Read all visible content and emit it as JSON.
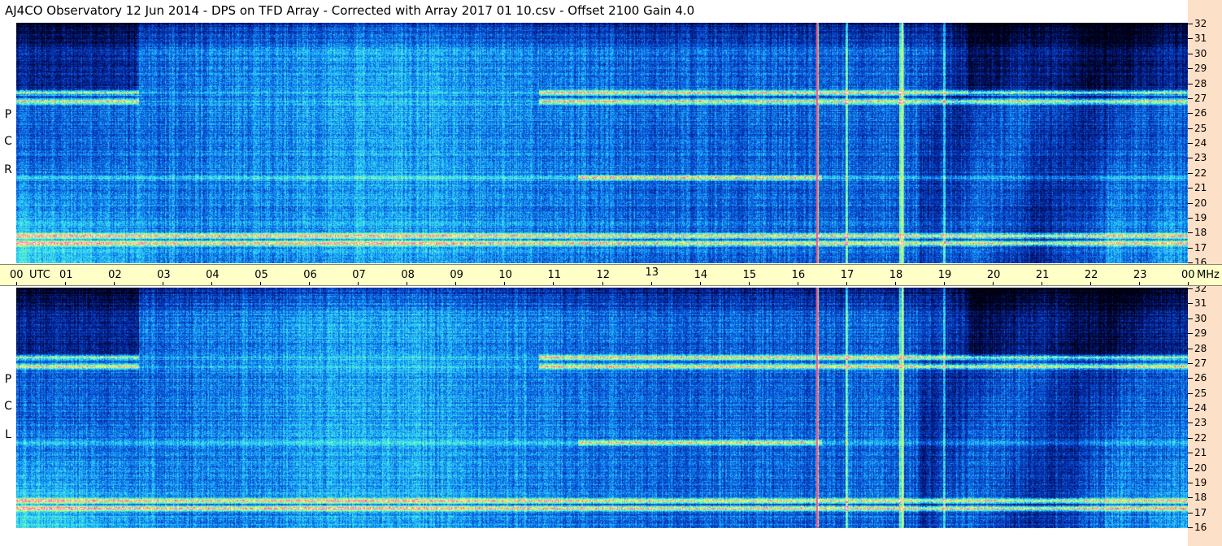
{
  "title": "AJ4CO Observatory  12 Jun 2014  -  DPS on TFD Array  -  Corrected with Array 2017 01 10.csv  -  Offset 2100  Gain 4.0",
  "panels": [
    {
      "name": "rcp",
      "label_letters": [
        "P",
        "C",
        "R"
      ]
    },
    {
      "name": "lcp",
      "label_letters": [
        "P",
        "C",
        "L"
      ]
    }
  ],
  "chart_data": {
    "type": "heatmap",
    "subtype": "dynamic spectrogram",
    "x_axis": {
      "unit_label": "UTC",
      "range": [
        0,
        24
      ],
      "tick_labels": [
        "00",
        "01",
        "02",
        "03",
        "04",
        "05",
        "06",
        "07",
        "08",
        "09",
        "10",
        "11",
        "12",
        "13",
        "14",
        "15",
        "16",
        "17",
        "18",
        "19",
        "20",
        "21",
        "22",
        "23",
        "00"
      ]
    },
    "y_axis": {
      "unit_label": "MHz",
      "range": [
        16,
        32
      ],
      "tick_labels": [
        "32",
        "31",
        "30",
        "29",
        "28",
        "27",
        "26",
        "25",
        "24",
        "23",
        "22",
        "21",
        "20",
        "19",
        "18",
        "17",
        "16"
      ]
    },
    "colormap": [
      "#000010",
      "#031a8c",
      "#0a5fe6",
      "#29d6ff",
      "#7dffb0",
      "#ffff50",
      "#ff3cc8",
      "#ffffff"
    ],
    "strong_bands_mhz": [
      17.3,
      17.8,
      21.7,
      26.8,
      27.4
    ],
    "vertical_interference_utc": [
      16.4,
      17.0,
      18.1,
      18.15,
      19.0
    ]
  },
  "utc_axis_label": "UTC",
  "mhz_axis_label": "MHz"
}
